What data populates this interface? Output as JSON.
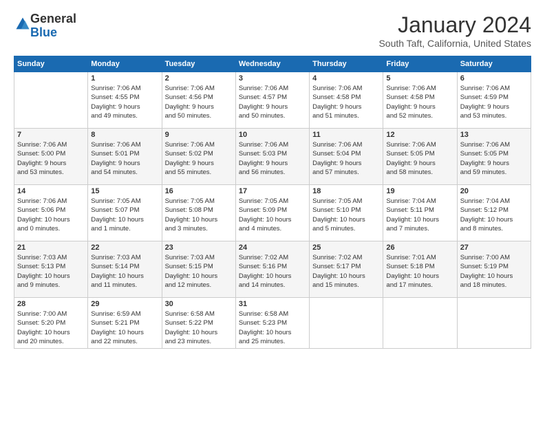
{
  "header": {
    "logo_general": "General",
    "logo_blue": "Blue",
    "month_title": "January 2024",
    "location": "South Taft, California, United States"
  },
  "days_of_week": [
    "Sunday",
    "Monday",
    "Tuesday",
    "Wednesday",
    "Thursday",
    "Friday",
    "Saturday"
  ],
  "weeks": [
    [
      {
        "day": "",
        "info": ""
      },
      {
        "day": "1",
        "info": "Sunrise: 7:06 AM\nSunset: 4:55 PM\nDaylight: 9 hours\nand 49 minutes."
      },
      {
        "day": "2",
        "info": "Sunrise: 7:06 AM\nSunset: 4:56 PM\nDaylight: 9 hours\nand 50 minutes."
      },
      {
        "day": "3",
        "info": "Sunrise: 7:06 AM\nSunset: 4:57 PM\nDaylight: 9 hours\nand 50 minutes."
      },
      {
        "day": "4",
        "info": "Sunrise: 7:06 AM\nSunset: 4:58 PM\nDaylight: 9 hours\nand 51 minutes."
      },
      {
        "day": "5",
        "info": "Sunrise: 7:06 AM\nSunset: 4:58 PM\nDaylight: 9 hours\nand 52 minutes."
      },
      {
        "day": "6",
        "info": "Sunrise: 7:06 AM\nSunset: 4:59 PM\nDaylight: 9 hours\nand 53 minutes."
      }
    ],
    [
      {
        "day": "7",
        "info": "Sunrise: 7:06 AM\nSunset: 5:00 PM\nDaylight: 9 hours\nand 53 minutes."
      },
      {
        "day": "8",
        "info": "Sunrise: 7:06 AM\nSunset: 5:01 PM\nDaylight: 9 hours\nand 54 minutes."
      },
      {
        "day": "9",
        "info": "Sunrise: 7:06 AM\nSunset: 5:02 PM\nDaylight: 9 hours\nand 55 minutes."
      },
      {
        "day": "10",
        "info": "Sunrise: 7:06 AM\nSunset: 5:03 PM\nDaylight: 9 hours\nand 56 minutes."
      },
      {
        "day": "11",
        "info": "Sunrise: 7:06 AM\nSunset: 5:04 PM\nDaylight: 9 hours\nand 57 minutes."
      },
      {
        "day": "12",
        "info": "Sunrise: 7:06 AM\nSunset: 5:05 PM\nDaylight: 9 hours\nand 58 minutes."
      },
      {
        "day": "13",
        "info": "Sunrise: 7:06 AM\nSunset: 5:05 PM\nDaylight: 9 hours\nand 59 minutes."
      }
    ],
    [
      {
        "day": "14",
        "info": "Sunrise: 7:06 AM\nSunset: 5:06 PM\nDaylight: 10 hours\nand 0 minutes."
      },
      {
        "day": "15",
        "info": "Sunrise: 7:05 AM\nSunset: 5:07 PM\nDaylight: 10 hours\nand 1 minute."
      },
      {
        "day": "16",
        "info": "Sunrise: 7:05 AM\nSunset: 5:08 PM\nDaylight: 10 hours\nand 3 minutes."
      },
      {
        "day": "17",
        "info": "Sunrise: 7:05 AM\nSunset: 5:09 PM\nDaylight: 10 hours\nand 4 minutes."
      },
      {
        "day": "18",
        "info": "Sunrise: 7:05 AM\nSunset: 5:10 PM\nDaylight: 10 hours\nand 5 minutes."
      },
      {
        "day": "19",
        "info": "Sunrise: 7:04 AM\nSunset: 5:11 PM\nDaylight: 10 hours\nand 7 minutes."
      },
      {
        "day": "20",
        "info": "Sunrise: 7:04 AM\nSunset: 5:12 PM\nDaylight: 10 hours\nand 8 minutes."
      }
    ],
    [
      {
        "day": "21",
        "info": "Sunrise: 7:03 AM\nSunset: 5:13 PM\nDaylight: 10 hours\nand 9 minutes."
      },
      {
        "day": "22",
        "info": "Sunrise: 7:03 AM\nSunset: 5:14 PM\nDaylight: 10 hours\nand 11 minutes."
      },
      {
        "day": "23",
        "info": "Sunrise: 7:03 AM\nSunset: 5:15 PM\nDaylight: 10 hours\nand 12 minutes."
      },
      {
        "day": "24",
        "info": "Sunrise: 7:02 AM\nSunset: 5:16 PM\nDaylight: 10 hours\nand 14 minutes."
      },
      {
        "day": "25",
        "info": "Sunrise: 7:02 AM\nSunset: 5:17 PM\nDaylight: 10 hours\nand 15 minutes."
      },
      {
        "day": "26",
        "info": "Sunrise: 7:01 AM\nSunset: 5:18 PM\nDaylight: 10 hours\nand 17 minutes."
      },
      {
        "day": "27",
        "info": "Sunrise: 7:00 AM\nSunset: 5:19 PM\nDaylight: 10 hours\nand 18 minutes."
      }
    ],
    [
      {
        "day": "28",
        "info": "Sunrise: 7:00 AM\nSunset: 5:20 PM\nDaylight: 10 hours\nand 20 minutes."
      },
      {
        "day": "29",
        "info": "Sunrise: 6:59 AM\nSunset: 5:21 PM\nDaylight: 10 hours\nand 22 minutes."
      },
      {
        "day": "30",
        "info": "Sunrise: 6:58 AM\nSunset: 5:22 PM\nDaylight: 10 hours\nand 23 minutes."
      },
      {
        "day": "31",
        "info": "Sunrise: 6:58 AM\nSunset: 5:23 PM\nDaylight: 10 hours\nand 25 minutes."
      },
      {
        "day": "",
        "info": ""
      },
      {
        "day": "",
        "info": ""
      },
      {
        "day": "",
        "info": ""
      }
    ]
  ]
}
